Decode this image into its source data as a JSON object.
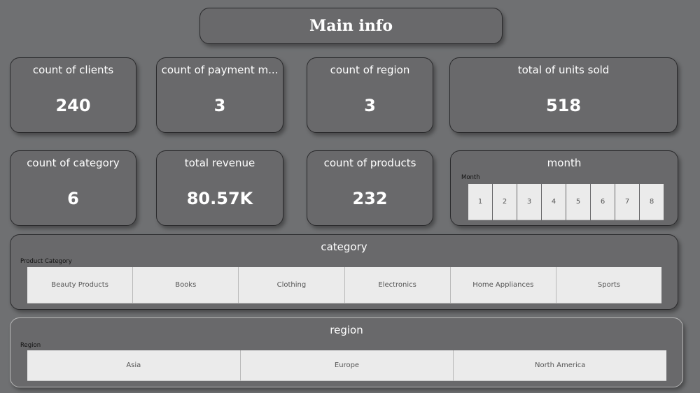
{
  "header": {
    "title": "Main info"
  },
  "kpis": {
    "clients": {
      "label": "count of clients",
      "value": "240"
    },
    "payment": {
      "label": "count of payment m...",
      "value": "3"
    },
    "region": {
      "label": "count of region",
      "value": "3"
    },
    "units": {
      "label": "total of units sold",
      "value": "518"
    },
    "category": {
      "label": "count of category",
      "value": "6"
    },
    "revenue": {
      "label": "total revenue",
      "value": "80.57K"
    },
    "products": {
      "label": "count of products",
      "value": "232"
    }
  },
  "month_slicer": {
    "title": "month",
    "header": "Month",
    "items": [
      "1",
      "2",
      "3",
      "4",
      "5",
      "6",
      "7",
      "8"
    ]
  },
  "category_slicer": {
    "title": "category",
    "header": "Product Category",
    "items": [
      "Beauty Products",
      "Books",
      "Clothing",
      "Electronics",
      "Home Appliances",
      "Sports"
    ]
  },
  "region_slicer": {
    "title": "region",
    "header": "Region",
    "items": [
      "Asia",
      "Europe",
      "North America"
    ]
  },
  "colors": {
    "background": "#6f7072",
    "card": "#69696b",
    "tile": "#ebebeb",
    "text": "#ffffff"
  }
}
